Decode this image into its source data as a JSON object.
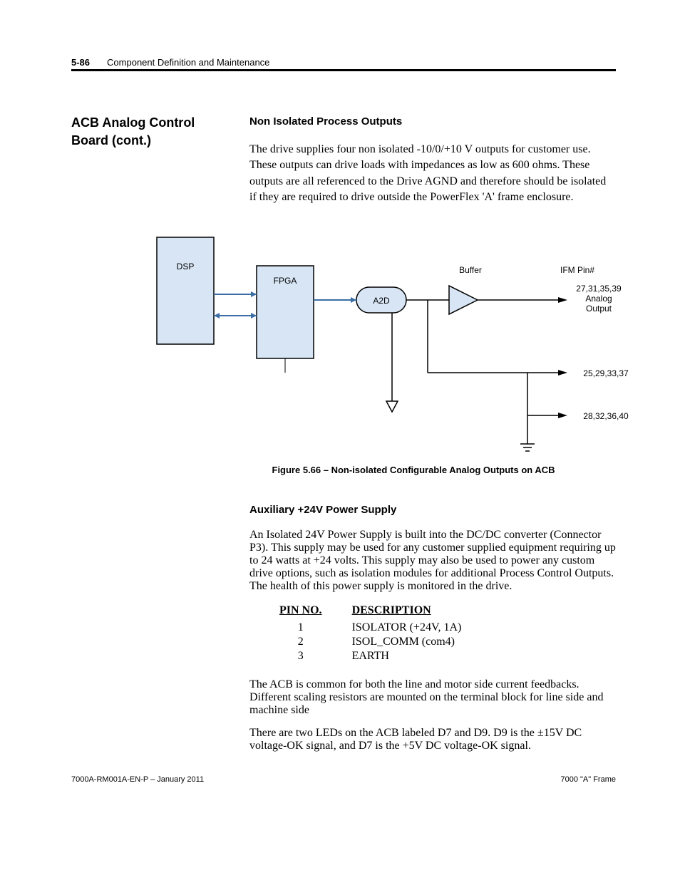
{
  "header": {
    "page_number": "5-86",
    "running_title": "Component Definition and Maintenance"
  },
  "sidebar": {
    "section_title_line1": "ACB Analog Control",
    "section_title_line2": "Board  (cont.)"
  },
  "section1": {
    "heading": "Non Isolated Process Outputs",
    "paragraph": "The drive supplies four non isolated -10/0/+10 V outputs for customer use.  These outputs can drive loads with impedances as low as 600 ohms.  These outputs are all referenced to the Drive AGND and therefore should be isolated if they are required to drive outside the PowerFlex 'A' frame enclosure."
  },
  "figure": {
    "caption": "Figure 5.66 – Non-isolated Configurable Analog Outputs on ACB",
    "labels": {
      "dsp": "DSP",
      "fpga": "FPGA",
      "a2d": "A2D",
      "buffer": "Buffer",
      "ifm_pin": "IFM Pin#",
      "analog_output": "Analog Output",
      "pins_top": "27,31,35,39",
      "pins_mid": "25,29,33,37",
      "pins_bot": "28,32,36,40"
    }
  },
  "section2": {
    "heading": "Auxiliary +24V Power Supply",
    "paragraph": "An Isolated 24V Power Supply is built into the DC/DC converter (Connector P3).  This supply may be used for any customer supplied equipment requiring up to 24 watts at +24 volts.  This supply may also be used to power any custom drive options, such as isolation modules for additional Process Control Outputs.  The health of this power supply is monitored in the drive.",
    "table": {
      "headers": {
        "pin": "PIN NO.",
        "desc": "DESCRIPTION"
      },
      "rows": [
        {
          "pin": "1",
          "desc": "ISOLATOR (+24V, 1A)"
        },
        {
          "pin": "2",
          "desc": "ISOL_COMM (com4)"
        },
        {
          "pin": "3",
          "desc": "EARTH"
        }
      ]
    },
    "paragraph2": "The ACB is common for both the line and motor side current feedbacks.  Different scaling resistors are mounted on the terminal block for line side and machine side",
    "paragraph3": "There are two LEDs on the ACB labeled D7 and D9.  D9 is the ±15V DC voltage-OK signal, and D7 is the +5V DC voltage-OK signal."
  },
  "footer": {
    "left": "7000A-RM001A-EN-P –  January 2011",
    "right": "7000 \"A\" Frame"
  }
}
